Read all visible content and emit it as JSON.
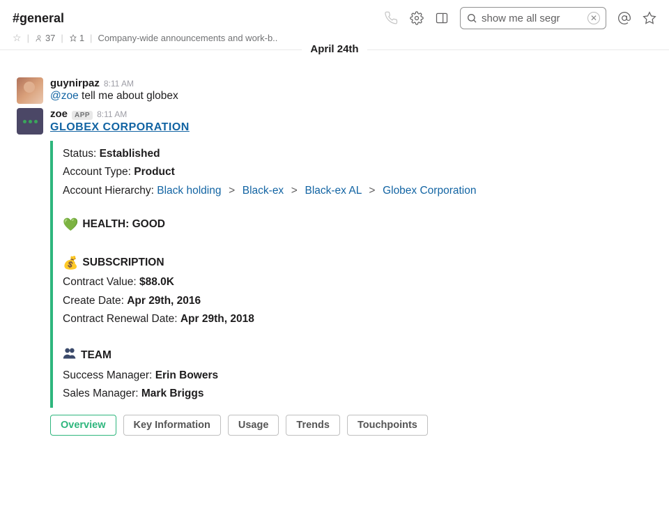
{
  "header": {
    "channel_name": "#general",
    "member_count": "37",
    "pin_count": "1",
    "topic": "Company-wide announcements and work-b..",
    "search_value": "show me all segr"
  },
  "divider_date": "April 24th",
  "msg1": {
    "user": "guynirpaz",
    "time": "8:11 AM",
    "mention": "@zoe",
    "text_rest": " tell me about globex"
  },
  "msg2": {
    "user": "zoe",
    "app_badge": "APP",
    "time": "8:11 AM",
    "company": "GLOBEX CORPORATION"
  },
  "card": {
    "status_label": "Status: ",
    "status_value": "Established",
    "type_label": "Account Type: ",
    "type_value": "Product",
    "hierarchy_label": "Account Hierarchy: ",
    "hierarchy": {
      "a": "Black holding",
      "b": "Black-ex",
      "c": "Black-ex AL",
      "d": "Globex Corporation"
    },
    "health_head": "HEALTH: GOOD",
    "sub_head": "SUBSCRIPTION",
    "cv_label": "Contract Value: ",
    "cv_value": "$88.0K",
    "cd_label": "Create Date: ",
    "cd_value": "Apr 29th, 2016",
    "crd_label": "Contract Renewal Date: ",
    "crd_value": "Apr 29th, 2018",
    "team_head": "TEAM",
    "sm_label": "Success Manager: ",
    "sm_value": "Erin Bowers",
    "slm_label": "Sales Manager: ",
    "slm_value": "Mark Briggs"
  },
  "actions": {
    "a": "Overview",
    "b": "Key Information",
    "c": "Usage",
    "d": "Trends",
    "e": "Touchpoints"
  }
}
